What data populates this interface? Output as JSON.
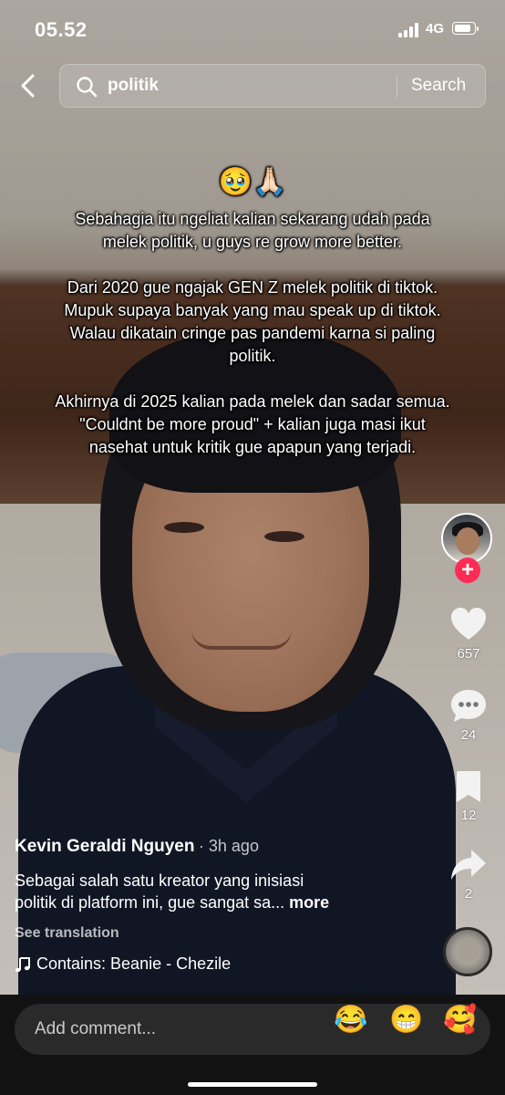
{
  "status_bar": {
    "time": "05.52",
    "network": "4G"
  },
  "search": {
    "query": "politik",
    "button_label": "Search"
  },
  "overlay": {
    "emoji": "🥹🙏🏻",
    "paragraphs": [
      [
        "Sebahagia itu ngeliat kalian sekarang udah pada",
        "melek politik, u guys re grow more better."
      ],
      [
        "Dari 2020 gue ngajak GEN Z melek politik di tiktok.",
        "Mupuk supaya banyak yang mau speak up di tiktok.",
        "Walau dikatain cringe pas pandemi karna si paling",
        "politik."
      ],
      [
        "Akhirnya di 2025 kalian pada melek dan sadar semua.",
        "\"Couldnt be more proud\" + kalian juga masi ikut",
        "nasehat untuk kritik gue apapun yang terjadi."
      ]
    ]
  },
  "actions": {
    "likes": "657",
    "comments": "24",
    "bookmarks": "12",
    "shares": "2"
  },
  "post": {
    "author": "Kevin Geraldi Nguyen",
    "time_ago": "· 3h ago",
    "description_line1": "Sebagai salah satu kreator yang inisiasi",
    "description_line2": "politik di platform ini, gue sangat sa...",
    "more_label": "more",
    "see_translation": "See translation",
    "music": "Contains: Beanie - Chezile"
  },
  "comment_bar": {
    "placeholder": "Add comment...",
    "quick_emojis": [
      "😂",
      "😁",
      "🥰"
    ]
  },
  "colors": {
    "follow_accent": "#fe2c55",
    "comment_bar_bg": "#121212",
    "input_bg": "#2a2a2a"
  }
}
